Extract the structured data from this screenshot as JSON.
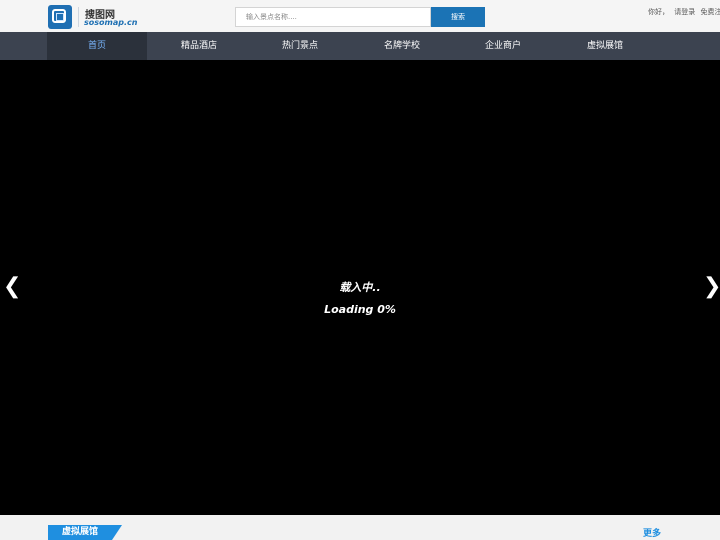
{
  "header": {
    "logo_title": "搜图网",
    "logo_sub": "sosomap.cn",
    "search_placeholder": "输入景点名称....",
    "search_button": "搜索",
    "greeting": "你好，",
    "login": "请登录",
    "register": "免费注册"
  },
  "nav": {
    "items": [
      "首页",
      "精品酒店",
      "热门景点",
      "名牌学校",
      "企业商户",
      "虚拟展馆"
    ]
  },
  "viewer": {
    "left_arrow": "❮",
    "right_arrow": "❯",
    "loading_title": "载入中..",
    "loading_progress": "Loading 0%"
  },
  "section": {
    "title": "虚拟展馆",
    "more": "更多"
  }
}
